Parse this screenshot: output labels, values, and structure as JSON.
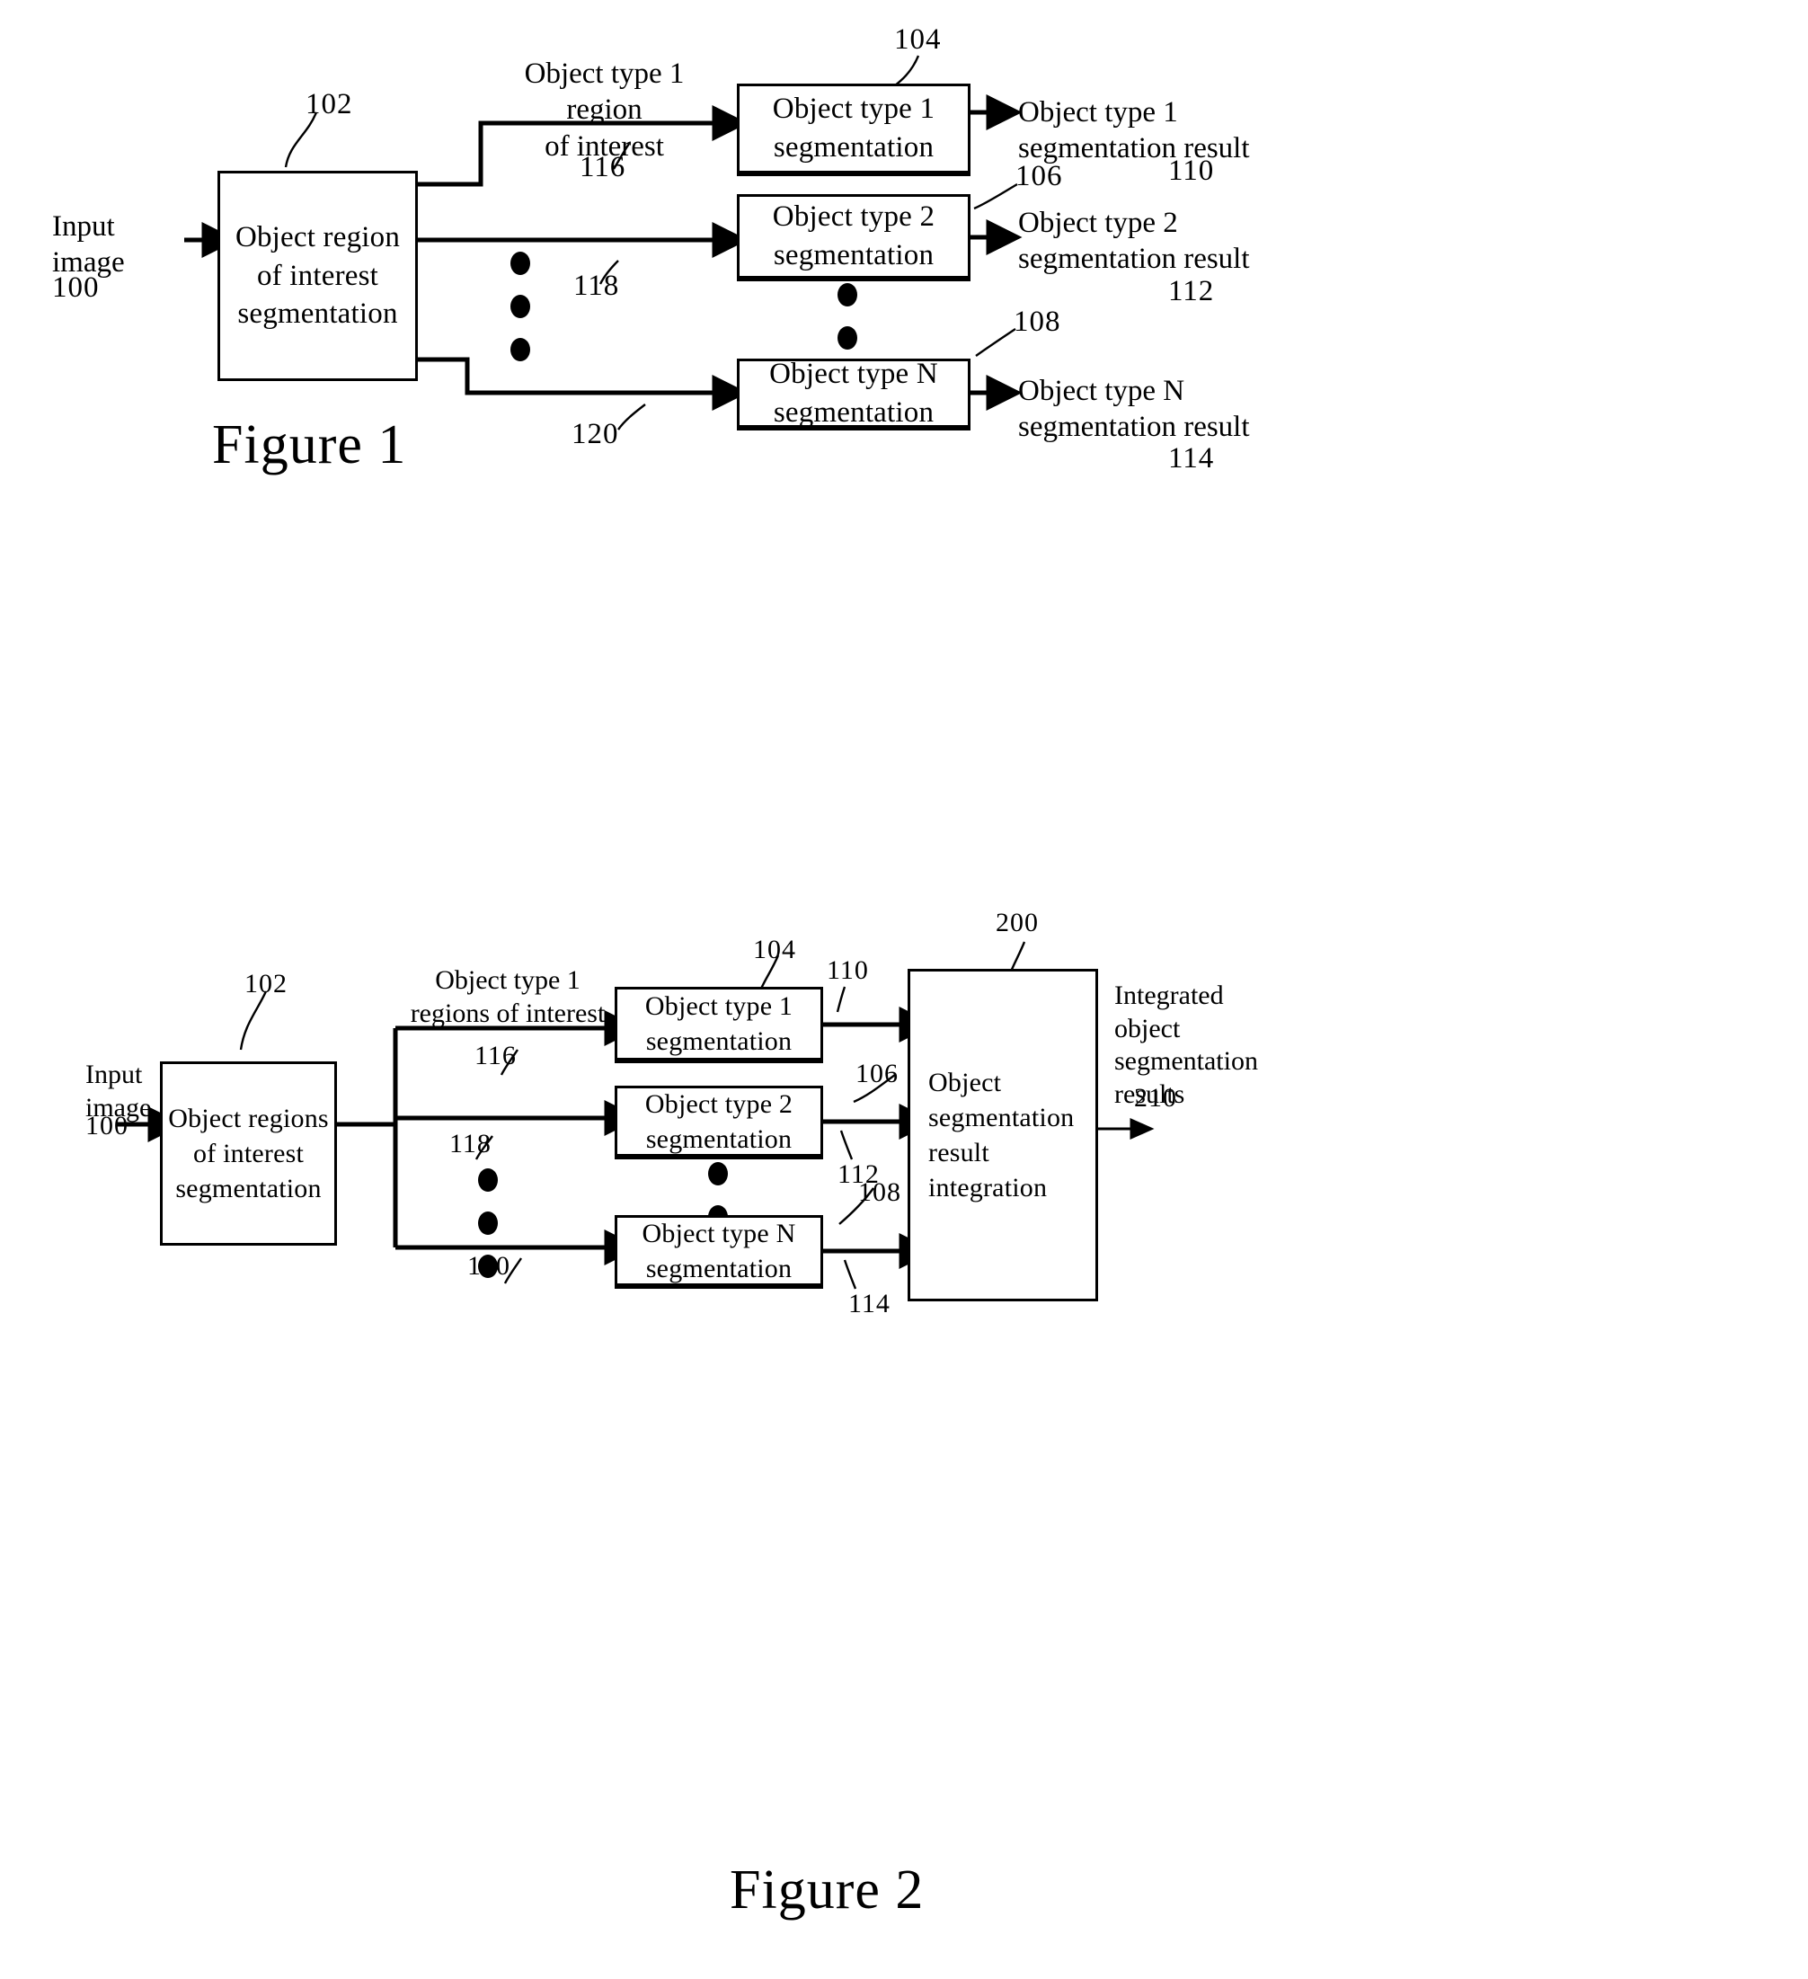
{
  "document": {
    "type": "patent-drawing-sheet",
    "background_color": "#ffffff",
    "ink_color": "#000000"
  },
  "figure1": {
    "caption": "Figure 1",
    "input_label": "Input\nimage",
    "input_ref": "100",
    "blocks": [
      {
        "id": "roi",
        "text": "Object region\nof interest\nsegmentation",
        "ref": "102"
      },
      {
        "id": "seg1",
        "text": "Object type 1\nsegmentation",
        "ref": "104"
      },
      {
        "id": "seg2",
        "text": "Object type 2\nsegmentation",
        "ref": "106"
      },
      {
        "id": "segN",
        "text": "Object type N\nsegmentation",
        "ref": "108"
      }
    ],
    "edge_labels": [
      {
        "id": "roi1",
        "text": "Object type 1 region\nof interest",
        "ref": "116"
      },
      {
        "id": "roi2",
        "text": "",
        "ref": "118"
      },
      {
        "id": "roiN",
        "text": "",
        "ref": "120"
      }
    ],
    "outputs": [
      {
        "id": "out1",
        "text": "Object type 1\nsegmentation result",
        "ref": "110"
      },
      {
        "id": "out2",
        "text": "Object type 2\nsegmentation result",
        "ref": "112"
      },
      {
        "id": "outN",
        "text": "Object type N\nsegmentation result",
        "ref": "114"
      }
    ],
    "ellipsis_note": "vertical three-dot ellipsis indicating repeated rows"
  },
  "figure2": {
    "caption": "Figure 2",
    "input_label": "Input\nimage",
    "input_ref": "100",
    "blocks": [
      {
        "id": "roi",
        "text": "Object regions\nof interest\nsegmentation",
        "ref": "102"
      },
      {
        "id": "seg1",
        "text": "Object type 1\nsegmentation",
        "ref": "104"
      },
      {
        "id": "seg2",
        "text": "Object type 2\nsegmentation",
        "ref": "106"
      },
      {
        "id": "segN",
        "text": "Object type N\nsegmentation",
        "ref": "108"
      },
      {
        "id": "integ",
        "text": "Object\nsegmentation\nresult\nintegration",
        "ref": "200"
      }
    ],
    "edge_labels": [
      {
        "id": "roi1",
        "text": "Object type 1\nregions of interest",
        "ref": "116"
      },
      {
        "id": "roi2",
        "text": "",
        "ref": "118"
      },
      {
        "id": "roiN",
        "text": "",
        "ref": "120"
      }
    ],
    "result_refs": [
      {
        "id": "r110",
        "ref": "110"
      },
      {
        "id": "r112",
        "ref": "112"
      },
      {
        "id": "r114",
        "ref": "114"
      }
    ],
    "output": {
      "text": "Integrated\nobject\nsegmentation\nresults",
      "ref": "210"
    },
    "ellipsis_note": "vertical three-dot ellipsis indicating repeated rows"
  }
}
